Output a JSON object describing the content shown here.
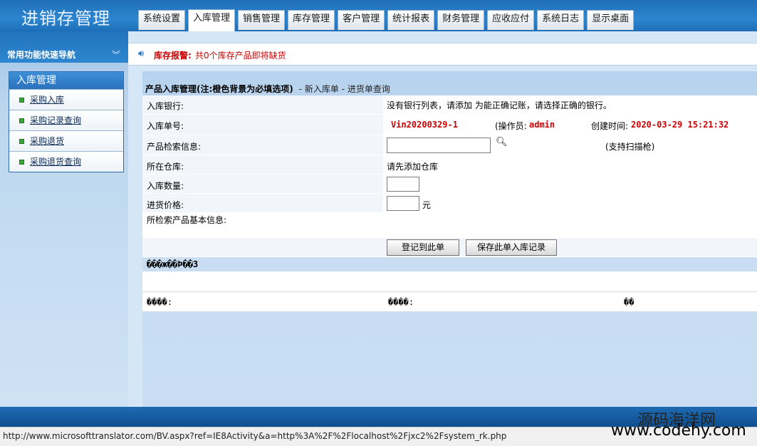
{
  "app": {
    "title": "进销存管理"
  },
  "nav": [
    {
      "label": "系统设置"
    },
    {
      "label": "入库管理"
    },
    {
      "label": "销售管理"
    },
    {
      "label": "库存管理"
    },
    {
      "label": "客户管理"
    },
    {
      "label": "统计报表"
    },
    {
      "label": "财务管理"
    },
    {
      "label": "应收应付"
    },
    {
      "label": "系统日志"
    },
    {
      "label": "显示桌面"
    }
  ],
  "sidebar": {
    "header": "常用功能快速导航",
    "panel_title": "入库管理",
    "items": [
      {
        "label": "采购入库"
      },
      {
        "label": "采购记录查询"
      },
      {
        "label": "采购退货"
      },
      {
        "label": "采购退货查询"
      }
    ]
  },
  "alert": {
    "label": "库存报警:",
    "message": "共0个库存产品即将缺货"
  },
  "section": {
    "title": "产品入库管理(注:橙色背景为必填选项)",
    "links": "- 新入库单 - 进货单查询"
  },
  "form": {
    "bank_label": "入库银行:",
    "bank_value": "没有银行列表，请添加 为能正确记账，请选择正确的银行。",
    "order_label": "入库单号:",
    "order_no": "Vin20200329-1",
    "operator_label": "(操作员:",
    "operator": "admin",
    "created_label": "创建时间:",
    "created_time": "2020-03-29 15:21:32",
    "search_label": "产品检索信息:",
    "search_value": "",
    "scanner_note": "(支持扫描枪)",
    "warehouse_label": "所在仓库:",
    "warehouse_value": "请先添加仓库",
    "qty_label": "入库数量:",
    "qty_value": "",
    "price_label": "进货价格:",
    "price_value": "",
    "price_unit": "元",
    "basic_info_label": "所检索产品基本信息:",
    "register_button": "登记到此单",
    "save_button": "保存此单入库记录"
  },
  "garbled": {
    "heading": "���ж��Ϸ��3",
    "col1": "����:",
    "col2": "����:",
    "col3": "��"
  },
  "status_url": "http://www.microsofttranslator.com/BV.aspx?ref=IE8Activity&a=http%3A%2F%2Flocalhost%2Fjxc2%2Fsystem_rk.php",
  "watermark": {
    "cn": "源码海洋网",
    "en": "www.codehy.com"
  }
}
